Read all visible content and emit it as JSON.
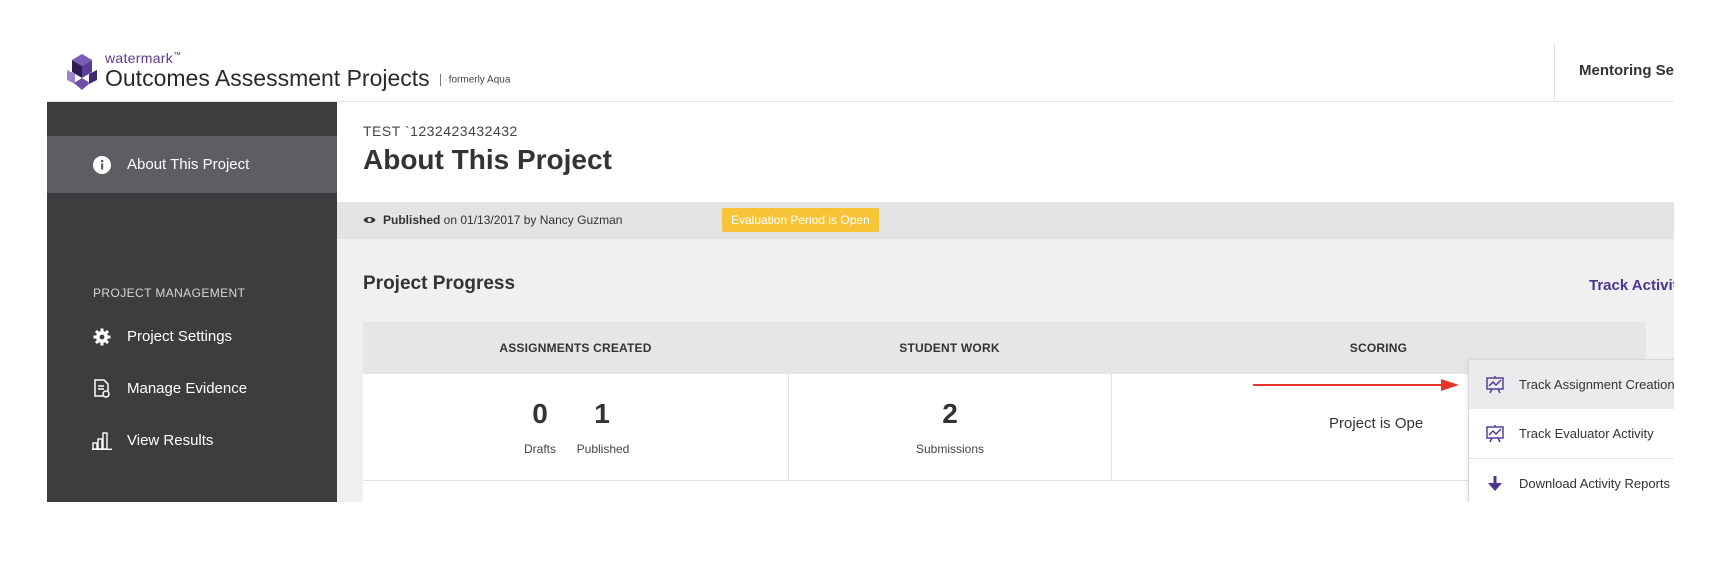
{
  "header": {
    "brand_small": "watermark",
    "brand_tm": "™",
    "app_name": "Outcomes Assessment Projects",
    "formerly": "formerly Aqua",
    "right_label": "Mentoring Se"
  },
  "sidebar": {
    "items": [
      {
        "label": "About This Project",
        "icon": "info-icon",
        "active": true
      },
      {
        "label": "Project Settings",
        "icon": "gear-icon",
        "active": false
      },
      {
        "label": "Manage Evidence",
        "icon": "evidence-icon",
        "active": false
      },
      {
        "label": "View Results",
        "icon": "bar-chart-icon",
        "active": false
      }
    ],
    "section_heading": "PROJECT MANAGEMENT"
  },
  "main": {
    "breadcrumb": "TEST `1232423432432",
    "title": "About This Project",
    "published_label": "Published",
    "published_rest": " on 01/13/2017 by Nancy Guzman",
    "status_badge": "Evaluation Period is Open",
    "section_title": "Project Progress",
    "track_activity": "Track Activity",
    "columns": [
      {
        "header": "ASSIGNMENTS CREATED"
      },
      {
        "header": "STUDENT WORK"
      },
      {
        "header": "SCORING"
      }
    ],
    "stats": {
      "drafts_value": "0",
      "drafts_label": "Drafts",
      "published_value": "1",
      "published_label": "Published",
      "submissions_value": "2",
      "submissions_label": "Submissions",
      "scoring_text": "Project is Ope"
    }
  },
  "dropdown": {
    "items": [
      {
        "label": "Track Assignment Creation",
        "icon": "presentation-chart-icon"
      },
      {
        "label": "Track Evaluator Activity",
        "icon": "presentation-chart-icon"
      },
      {
        "label": "Download Activity Reports",
        "icon": "download-arrow-icon"
      }
    ]
  },
  "colors": {
    "sidebar_bg": "#3d3d40",
    "sidebar_active": "#5e5e62",
    "accent_purple": "#4b3591",
    "badge_yellow": "#f7c437",
    "annotation_red": "#e8352c"
  }
}
